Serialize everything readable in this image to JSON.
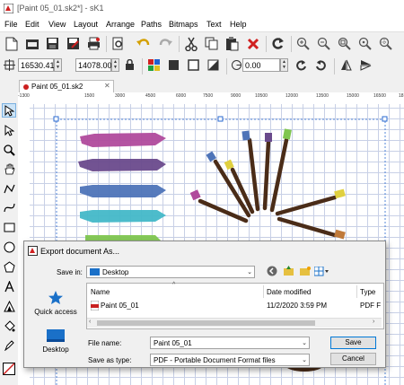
{
  "window": {
    "title": "[Paint 05_01.sk2*] - sK1"
  },
  "menu": [
    "File",
    "Edit",
    "View",
    "Layout",
    "Arrange",
    "Paths",
    "Bitmaps",
    "Text",
    "Help"
  ],
  "toolbar2": {
    "x_value": "16530.41",
    "y_value": "14078.00",
    "rotation_value": "0.00"
  },
  "document_tab": {
    "label": "Paint 05_01.sk2"
  },
  "ruler": {
    "h_labels": [
      "-1300",
      "1500",
      "3000",
      "4500",
      "6000",
      "7500",
      "9000",
      "10500",
      "12000",
      "13500",
      "15000",
      "16500",
      "18"
    ]
  },
  "colors": {
    "magenta": "#b04a9c",
    "purple": "#6a4a8c",
    "blue": "#4e74b8",
    "cyan": "#43b8c8",
    "green": "#80c650",
    "brush_handle": "#4a2c18",
    "selection": "#2a6ad0"
  },
  "dialog": {
    "title": "Export document As...",
    "save_in_label": "Save in:",
    "save_in_value": "Desktop",
    "places": [
      {
        "label": "Quick access",
        "icon": "quick-access-icon"
      },
      {
        "label": "Desktop",
        "icon": "desktop-icon"
      }
    ],
    "columns": {
      "name": "Name",
      "date": "Date modified",
      "type": "Type"
    },
    "files": [
      {
        "name": "Paint 05_01",
        "date": "11/2/2020 3:59 PM",
        "type": "PDF F"
      }
    ],
    "file_name_label": "File name:",
    "file_name_value": "Paint 05_01",
    "save_as_type_label": "Save as type:",
    "save_as_type_value": "PDF - Portable Document Format files",
    "save_button": "Save",
    "cancel_button": "Cancel"
  }
}
